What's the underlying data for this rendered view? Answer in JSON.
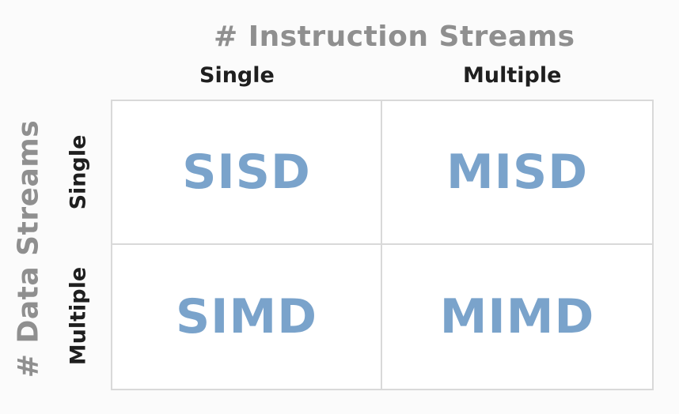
{
  "columns_title": "# Instruction Streams",
  "rows_title": "# Data Streams",
  "columns": [
    "Single",
    "Multiple"
  ],
  "rows": [
    "Single",
    "Multiple"
  ],
  "cells": {
    "single_single": "SISD",
    "single_multiple": "MISD",
    "multiple_single": "SIMD",
    "multiple_multiple": "MIMD"
  },
  "colors": {
    "cell_text": "#7aa3cb",
    "axis_title": "#8f8f8f",
    "label": "#1f1f1f",
    "grid_line": "#d9d9d9"
  }
}
